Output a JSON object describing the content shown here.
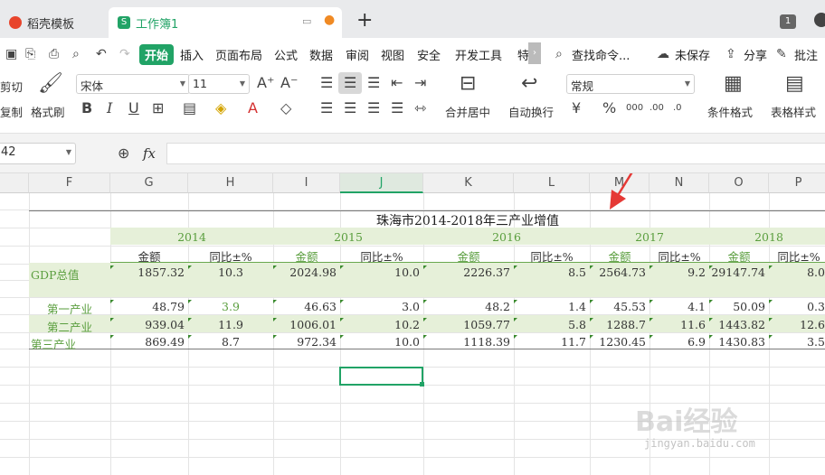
{
  "tabs": {
    "template_tab": "稻壳模板",
    "workbook_tab": "工作簿1",
    "new_tab": "+",
    "badge": "1"
  },
  "menu": [
    "开始",
    "插入",
    "页面布局",
    "公式",
    "数据",
    "审阅",
    "视图",
    "安全",
    "开发工具",
    "特"
  ],
  "menu_right": {
    "search": "查找命令...",
    "unsaved": "未保存",
    "share": "分享",
    "comment": "批注"
  },
  "ribbon": {
    "cut": "剪切",
    "copy": "复制",
    "format_painter": "格式刷",
    "font_name": "宋体",
    "font_size": "11",
    "merge_center": "合并居中",
    "wrap_text": "自动换行",
    "number_format": "常规",
    "cond_format": "条件格式",
    "table_style": "表格样式"
  },
  "formula_bar": {
    "name_box": "42",
    "fx": "fx"
  },
  "columns": [
    "F",
    "G",
    "H",
    "I",
    "J",
    "K",
    "L",
    "M",
    "N",
    "O",
    "P"
  ],
  "sheet": {
    "title": "珠海市2014-2018年三产业增值",
    "years": [
      "2014",
      "2015",
      "2016",
      "2017",
      "2018"
    ],
    "amount_label": "金额",
    "yoy_label": "同比±%",
    "rows": [
      {
        "label": "GDP总值",
        "values": [
          "1857.32",
          "10.3",
          "2024.98",
          "10.0",
          "2226.37",
          "8.5",
          "2564.73",
          "9.2",
          "29147.74",
          "8.0"
        ]
      },
      {
        "label": "第一产业",
        "values": [
          "48.79",
          "3.9",
          "46.63",
          "3.0",
          "48.2",
          "1.4",
          "45.53",
          "4.1",
          "50.09",
          "0.3"
        ]
      },
      {
        "label": "第二产业",
        "values": [
          "939.04",
          "11.9",
          "1006.01",
          "10.2",
          "1059.77",
          "5.8",
          "1288.7",
          "11.6",
          "1443.82",
          "12.6"
        ]
      },
      {
        "label": "第三产业",
        "values": [
          "869.49",
          "8.7",
          "972.34",
          "10.0",
          "1118.39",
          "11.7",
          "1230.45",
          "6.9",
          "1430.83",
          "3.5"
        ]
      }
    ]
  },
  "watermark": {
    "brand": "Bai经验",
    "url": "jingyan.baidu.com"
  },
  "colors": {
    "accent": "#21a366",
    "band": "#e6f0d9",
    "arrow": "#e53935"
  }
}
